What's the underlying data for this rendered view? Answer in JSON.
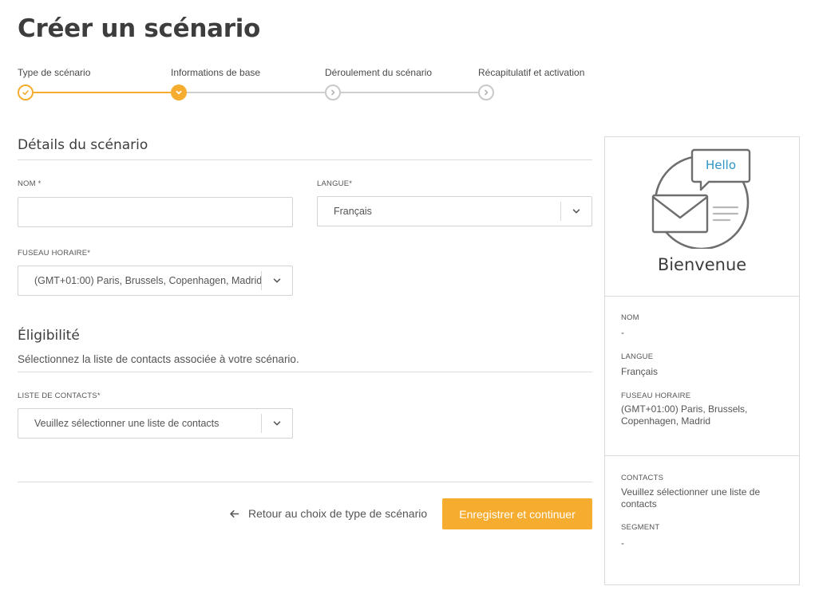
{
  "page": {
    "title": "Créer un scénario"
  },
  "stepper": {
    "steps": [
      {
        "label": "Type de scénario",
        "state": "done"
      },
      {
        "label": "Informations de base",
        "state": "current"
      },
      {
        "label": "Déroulement du scénario",
        "state": "todo"
      },
      {
        "label": "Récapitulatif et activation",
        "state": "todo"
      }
    ]
  },
  "details": {
    "title": "Détails du scénario",
    "name_label": "NOM *",
    "name_value": "",
    "language_label": "LANGUE*",
    "language_value": "Français",
    "timezone_label": "FUSEAU HORAIRE*",
    "timezone_value": "(GMT+01:00) Paris, Brussels, Copenhagen, Madrid"
  },
  "eligibility": {
    "title": "Éligibilité",
    "subtitle": "Sélectionnez la liste de contacts associée à votre scénario.",
    "contact_list_label": "LISTE DE CONTACTS*",
    "contact_list_placeholder": "Veuillez sélectionner une liste de contacts"
  },
  "actions": {
    "back_label": "Retour au choix de type de scénario",
    "primary_label": "Enregistrer et continuer"
  },
  "summary": {
    "illustration_text": "Hello",
    "heading": "Bienvenue",
    "name_label": "NOM",
    "name_value": "-",
    "language_label": "LANGUE",
    "language_value": "Français",
    "timezone_label": "FUSEAU HORAIRE",
    "timezone_value": "(GMT+01:00) Paris, Brussels, Copenhagen, Madrid",
    "contacts_label": "CONTACTS",
    "contacts_value": "Veuillez sélectionner une liste de contacts",
    "segment_label": "SEGMENT",
    "segment_value": "-"
  },
  "colors": {
    "accent": "#f5ac2f",
    "hello_text": "#2e94c6",
    "inactive": "#cfcfcf",
    "border": "#d3d3d3"
  },
  "icons": {
    "done_step": "check-icon",
    "current_step": "check-icon",
    "todo_step": "chevron-right-icon",
    "select_caret": "chevron-down-icon",
    "back": "arrow-left-icon"
  }
}
